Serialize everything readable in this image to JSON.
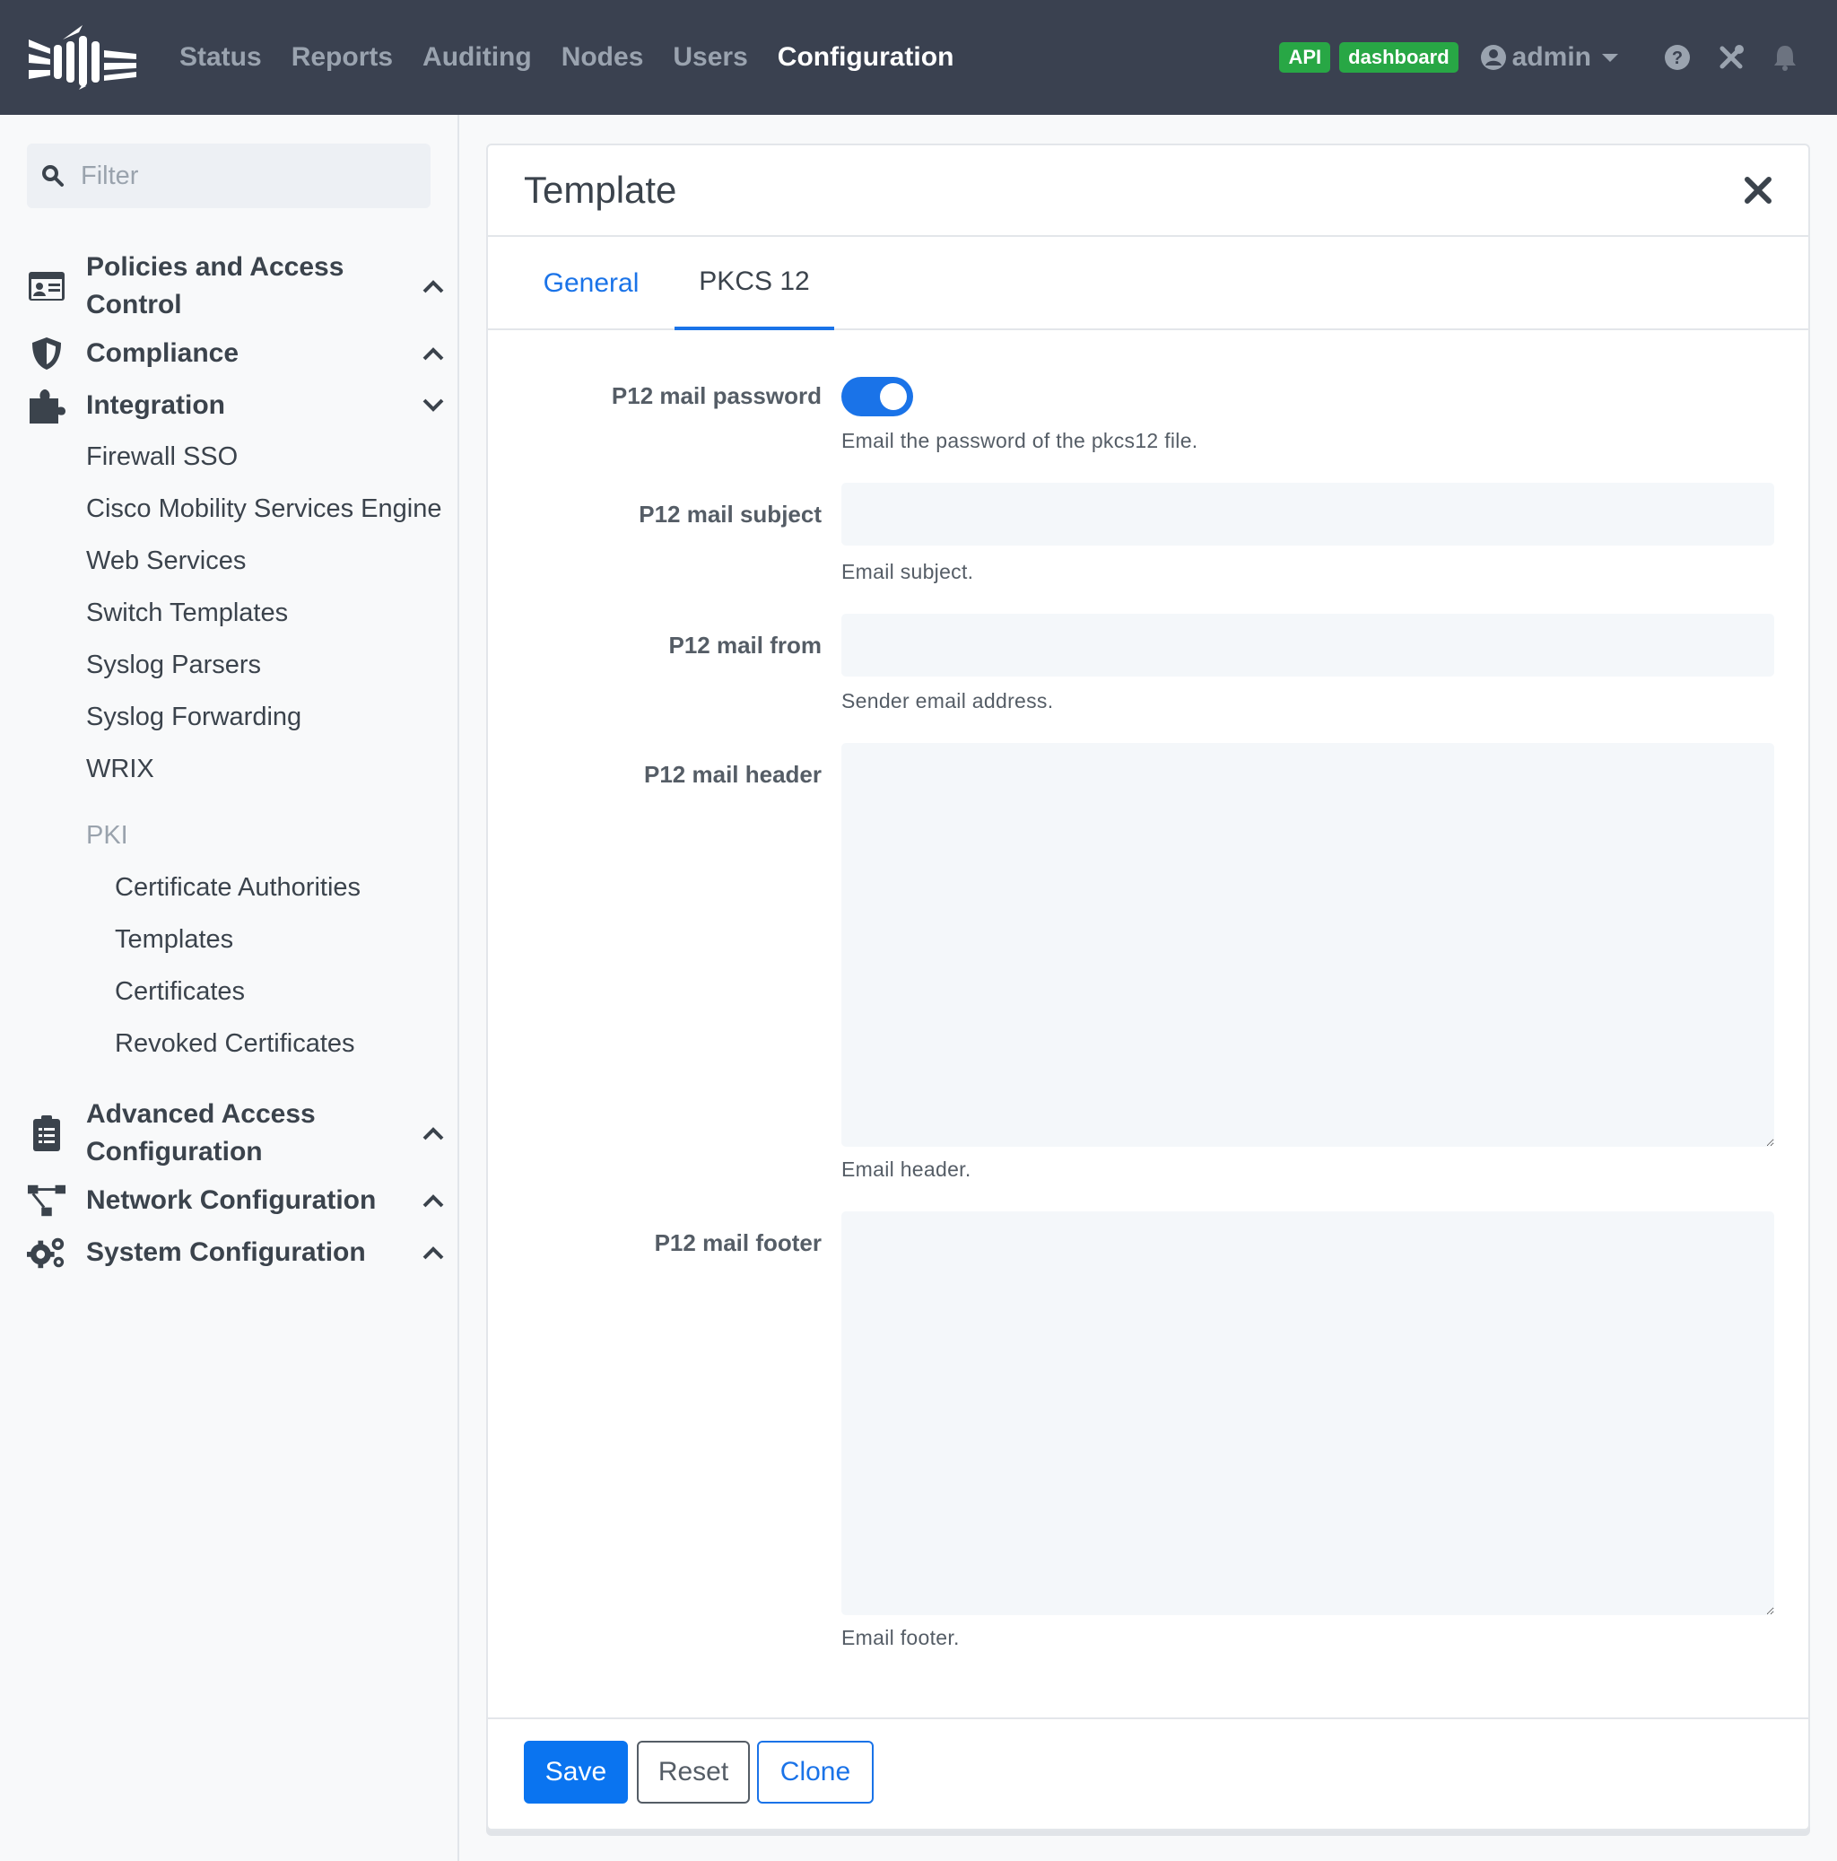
{
  "navbar": {
    "links": [
      "Status",
      "Reports",
      "Auditing",
      "Nodes",
      "Users",
      "Configuration"
    ],
    "active_link": "Configuration",
    "badges": [
      "API",
      "dashboard"
    ],
    "user": "admin",
    "icons": [
      "help-icon",
      "tools-icon",
      "bell-icon"
    ],
    "colors": {
      "background": "#3a4150",
      "badge": "#28a745"
    }
  },
  "sidebar": {
    "filter_placeholder": "Filter",
    "sections": [
      {
        "label": "Policies and Access Control",
        "icon": "id-card-icon",
        "expanded": false
      },
      {
        "label": "Compliance",
        "icon": "shield-icon",
        "expanded": false
      },
      {
        "label": "Integration",
        "icon": "puzzle-icon",
        "expanded": true
      },
      {
        "label": "Advanced Access Configuration",
        "icon": "clipboard-icon",
        "expanded": false
      },
      {
        "label": "Network Configuration",
        "icon": "network-icon",
        "expanded": false
      },
      {
        "label": "System Configuration",
        "icon": "gears-icon",
        "expanded": false
      }
    ],
    "integration_items": [
      "Firewall SSO",
      "Cisco Mobility Services Engine",
      "Web Services",
      "Switch Templates",
      "Syslog Parsers",
      "Syslog Forwarding",
      "WRIX"
    ],
    "pki_heading": "PKI",
    "pki_items": [
      "Certificate Authorities",
      "Templates",
      "Certificates",
      "Revoked Certificates"
    ]
  },
  "card": {
    "title": "Template",
    "tabs": [
      "General",
      "PKCS 12"
    ],
    "active_tab": "PKCS 12",
    "fields": {
      "mail_password": {
        "label": "P12 mail password",
        "enabled": true,
        "help": "Email the password of the pkcs12 file."
      },
      "mail_subject": {
        "label": "P12 mail subject",
        "value": "",
        "help": "Email subject."
      },
      "mail_from": {
        "label": "P12 mail from",
        "value": "",
        "help": "Sender email address."
      },
      "mail_header": {
        "label": "P12 mail header",
        "value": "",
        "help": "Email header."
      },
      "mail_footer": {
        "label": "P12 mail footer",
        "value": "",
        "help": "Email footer."
      }
    },
    "buttons": {
      "save": "Save",
      "reset": "Reset",
      "clone": "Clone"
    },
    "colors": {
      "primary": "#0a74f0",
      "tab_active": "#1a73e8"
    }
  }
}
